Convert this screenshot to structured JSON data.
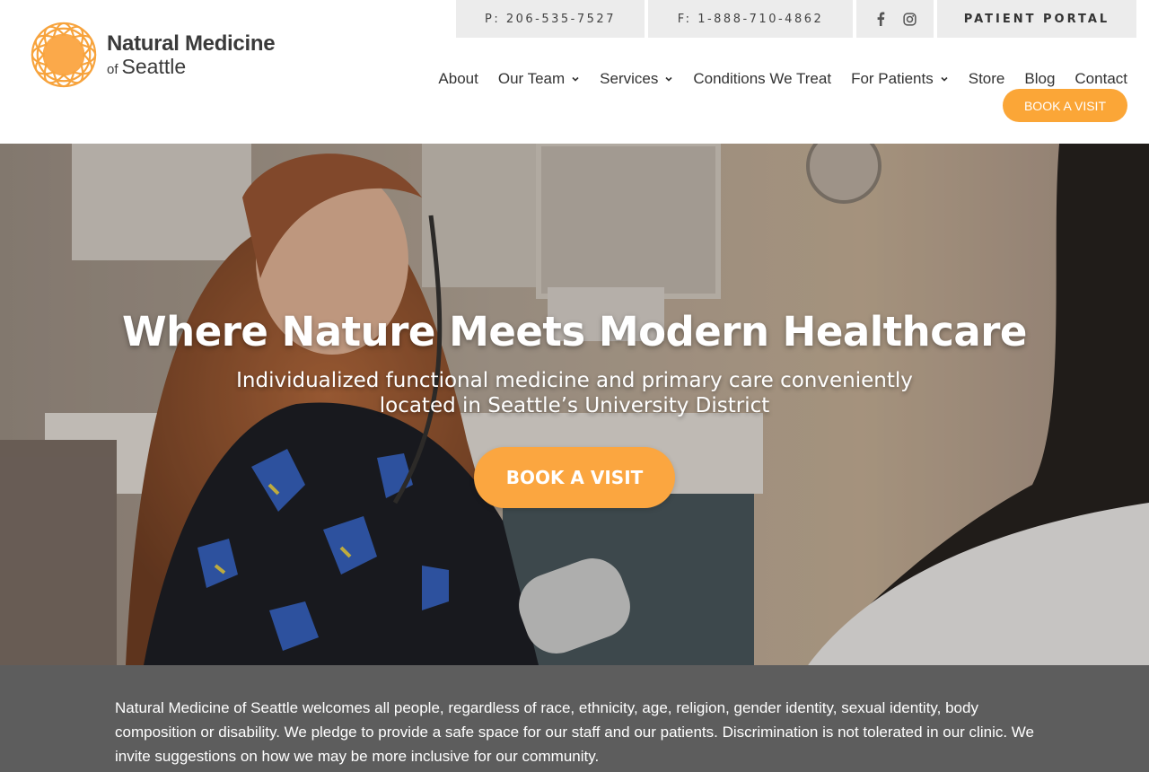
{
  "brand": {
    "name_line1": "Natural Medicine",
    "name_of": "of",
    "name_line2": "Seattle",
    "colors": {
      "accent": "#fba637",
      "logo": "#f7a33c",
      "text": "#333333",
      "statement_bg": "#5d5d5d"
    }
  },
  "topbar": {
    "phone": "P: 206-535-7527",
    "fax": "F: 1-888-710-4862",
    "social": [
      "facebook-icon",
      "instagram-icon"
    ],
    "portal": "PATIENT PORTAL"
  },
  "nav": {
    "items": [
      {
        "label": "About",
        "dropdown": false
      },
      {
        "label": "Our Team",
        "dropdown": true
      },
      {
        "label": "Services",
        "dropdown": true
      },
      {
        "label": "Conditions We Treat",
        "dropdown": false
      },
      {
        "label": "For Patients",
        "dropdown": true
      },
      {
        "label": "Store",
        "dropdown": false
      },
      {
        "label": "Blog",
        "dropdown": false
      },
      {
        "label": "Contact",
        "dropdown": false
      }
    ],
    "book_label": "BOOK A VISIT"
  },
  "hero": {
    "title": "Where Nature Meets Modern Healthcare",
    "subtitle": "Individualized functional medicine and primary care conveniently located in Seattle’s University District",
    "cta": "BOOK A VISIT"
  },
  "statement": {
    "text": "Natural Medicine of Seattle welcomes all people, regardless of race, ethnicity, age, religion, gender identity, sexual identity, body composition or disability. We pledge to provide a safe space for our staff and our patients. Discrimination is not tolerated in our clinic. We invite suggestions on how we may be more inclusive for our community."
  }
}
